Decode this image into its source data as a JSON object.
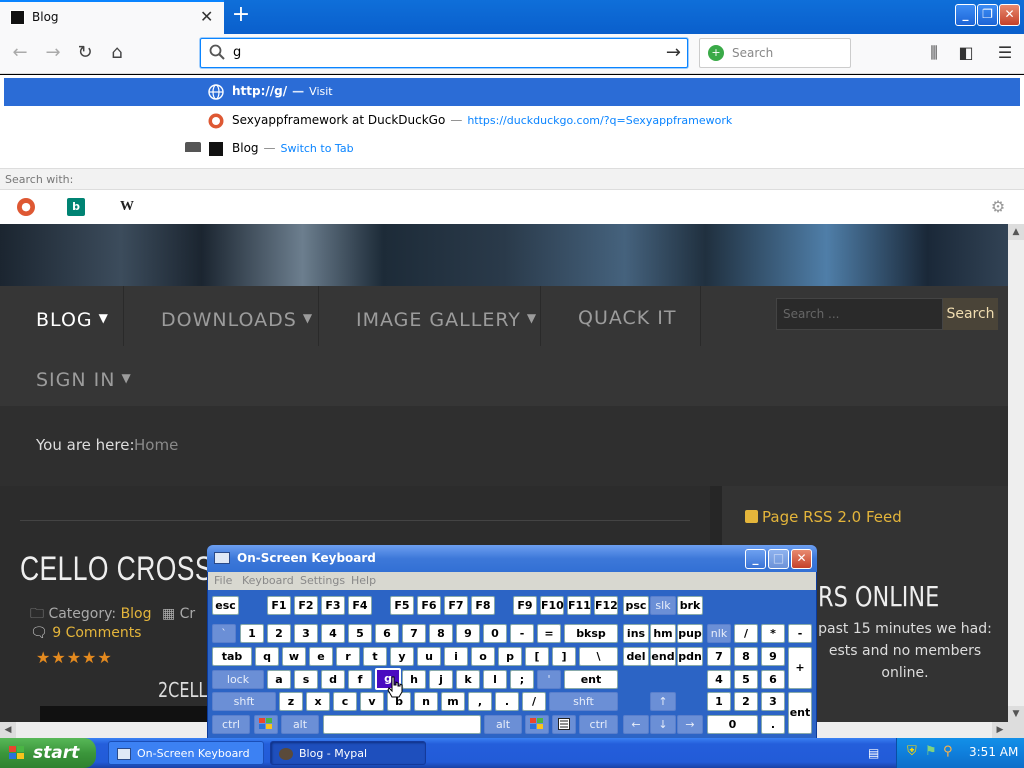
{
  "browser": {
    "tab": {
      "title": "Blog"
    },
    "url_value": "g",
    "search_placeholder": "Search",
    "dropdown": [
      {
        "title": "http://g/",
        "sub": "Visit"
      },
      {
        "title": "Sexyappframework at DuckDuckGo",
        "sub": "https://duckduckgo.com/?q=Sexyappframework"
      },
      {
        "title": "Blog",
        "sub": "Switch to Tab"
      }
    ],
    "search_with_label": "Search with:"
  },
  "site": {
    "menu": [
      {
        "label": "BLOG",
        "caret": "▼"
      },
      {
        "label": "DOWNLOADS",
        "caret": "▼"
      },
      {
        "label": "IMAGE GALLERY",
        "caret": "▼"
      },
      {
        "label": "QUACK IT",
        "caret": ""
      },
      {
        "label": "SIGN IN",
        "caret": "▼"
      }
    ],
    "search_placeholder": "Search ...",
    "search_button": "Search",
    "breadcrumb_label": "You are here:",
    "breadcrumb_home": "Home",
    "article": {
      "title": "CELLO CROSSO",
      "category_label": "Category:",
      "category": "Blog",
      "category_extra": "Cr",
      "comments": "9 Comments",
      "stars": "★★★★★",
      "subtitle": "2CELL"
    },
    "sidebar": {
      "rss": "Page RSS 2.0 Feed",
      "online_title": "RS ONLINE",
      "online_text": "past 15 minutes we had: ests and no members online."
    }
  },
  "osk": {
    "title": "On-Screen Keyboard",
    "menu": [
      "File",
      "Keyboard",
      "Settings",
      "Help"
    ],
    "row_fn": [
      "esc",
      "F1",
      "F2",
      "F3",
      "F4",
      "F5",
      "F6",
      "F7",
      "F8",
      "F9",
      "F10",
      "F11",
      "F12",
      "psc",
      "slk",
      "brk"
    ],
    "row_num": [
      "`",
      "1",
      "2",
      "3",
      "4",
      "5",
      "6",
      "7",
      "8",
      "9",
      "0",
      "-",
      "=",
      "bksp",
      "ins",
      "hm",
      "pup",
      "nlk",
      "/",
      "*",
      "-"
    ],
    "row_q": [
      "tab",
      "q",
      "w",
      "e",
      "r",
      "t",
      "y",
      "u",
      "i",
      "o",
      "p",
      "[",
      "]",
      "\\",
      "del",
      "end",
      "pdn",
      "7",
      "8",
      "9",
      "+"
    ],
    "row_a": [
      "lock",
      "a",
      "s",
      "d",
      "f",
      "g",
      "h",
      "j",
      "k",
      "l",
      ";",
      "'",
      "ent",
      "4",
      "5",
      "6"
    ],
    "row_z": [
      "shft",
      "z",
      "x",
      "c",
      "v",
      "b",
      "n",
      "m",
      ",",
      ".",
      "/",
      "shft",
      "↑",
      "1",
      "2",
      "3",
      "ent"
    ],
    "row_ctrl": [
      "ctrl",
      "alt",
      "alt",
      "ctrl",
      "←",
      "↓",
      "→",
      "0",
      "."
    ]
  },
  "taskbar": {
    "start": "start",
    "items": [
      "On-Screen Keyboard",
      "Blog - Mypal"
    ],
    "time": "3:51 AM"
  },
  "colors": {
    "accent": "#0a84ff",
    "site_link": "#e4b53b",
    "xp_blue": "#245edb",
    "start_green": "#3b963b"
  }
}
